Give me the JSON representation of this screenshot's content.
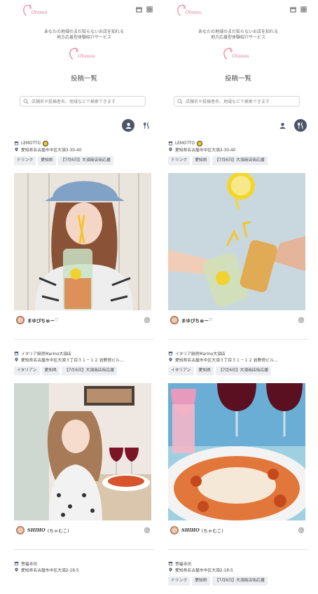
{
  "header": {
    "tagline_line1": "あなたの地域のまだ知らないお店を知れる",
    "tagline_line2": "地方応援型体験紹介サービス",
    "page_title": "投稿一覧"
  },
  "search": {
    "placeholder": "店舗名や投稿者名、地域などで検索できます"
  },
  "left": {
    "cards": [
      {
        "shop": "LEMOTTO",
        "address": "愛知県名古屋市中区大須3-30-40",
        "tags": [
          "ドリンク",
          "愛知県",
          "【7月6日】大須商店街応援"
        ],
        "user": "まゆぴちゅー",
        "user_suffix": "♡"
      },
      {
        "shop": "イタリア厨房Marino大須店",
        "address": "愛知県名古屋市中区大須３丁目３１－１２ 岩野房ビル…",
        "tags": [
          "イタリアン",
          "愛知県",
          "【7月6日】大須商店街応援"
        ],
        "user": "SHIHO",
        "user_suffix": "(ちゃむこ)"
      },
      {
        "shop": "菩福寺坊",
        "address": "愛知県名古屋市中区大須2-18-5",
        "tags": [],
        "user": "",
        "user_suffix": ""
      }
    ]
  },
  "right": {
    "cards": [
      {
        "shop": "LEMOTTO",
        "address": "愛知県名古屋市中区大須3-30-40",
        "tags": [
          "ドリンク",
          "愛知県",
          "【7月6日】大須商店街応援"
        ],
        "user": "まゆぴちゅー",
        "user_suffix": "♡"
      },
      {
        "shop": "イタリア厨房Marino大須店",
        "address": "愛知県名古屋市中区大須３丁目３１－１２ 岩野房ビル…",
        "tags": [
          "イタリアン",
          "愛知県",
          "【7月6日】大須商店街応援"
        ],
        "user": "SHIHO",
        "user_suffix": "(ちゃむこ)"
      },
      {
        "shop": "菩福寺坊",
        "address": "愛知県名古屋市中区大須2-18-5",
        "tags": [
          "ドリンク",
          "愛知県",
          "【7月6日】大須商店街応援"
        ],
        "user": "",
        "user_suffix": ""
      }
    ]
  },
  "colors": {
    "accent": "#4a5568",
    "tag_bg": "#eceef2",
    "logo_pink": "#e88aa0"
  },
  "icons": [
    "calendar-icon",
    "grid-icon",
    "search-icon",
    "user-icon",
    "fork-knife-icon",
    "store-icon",
    "location-pin-icon",
    "instagram-icon"
  ]
}
